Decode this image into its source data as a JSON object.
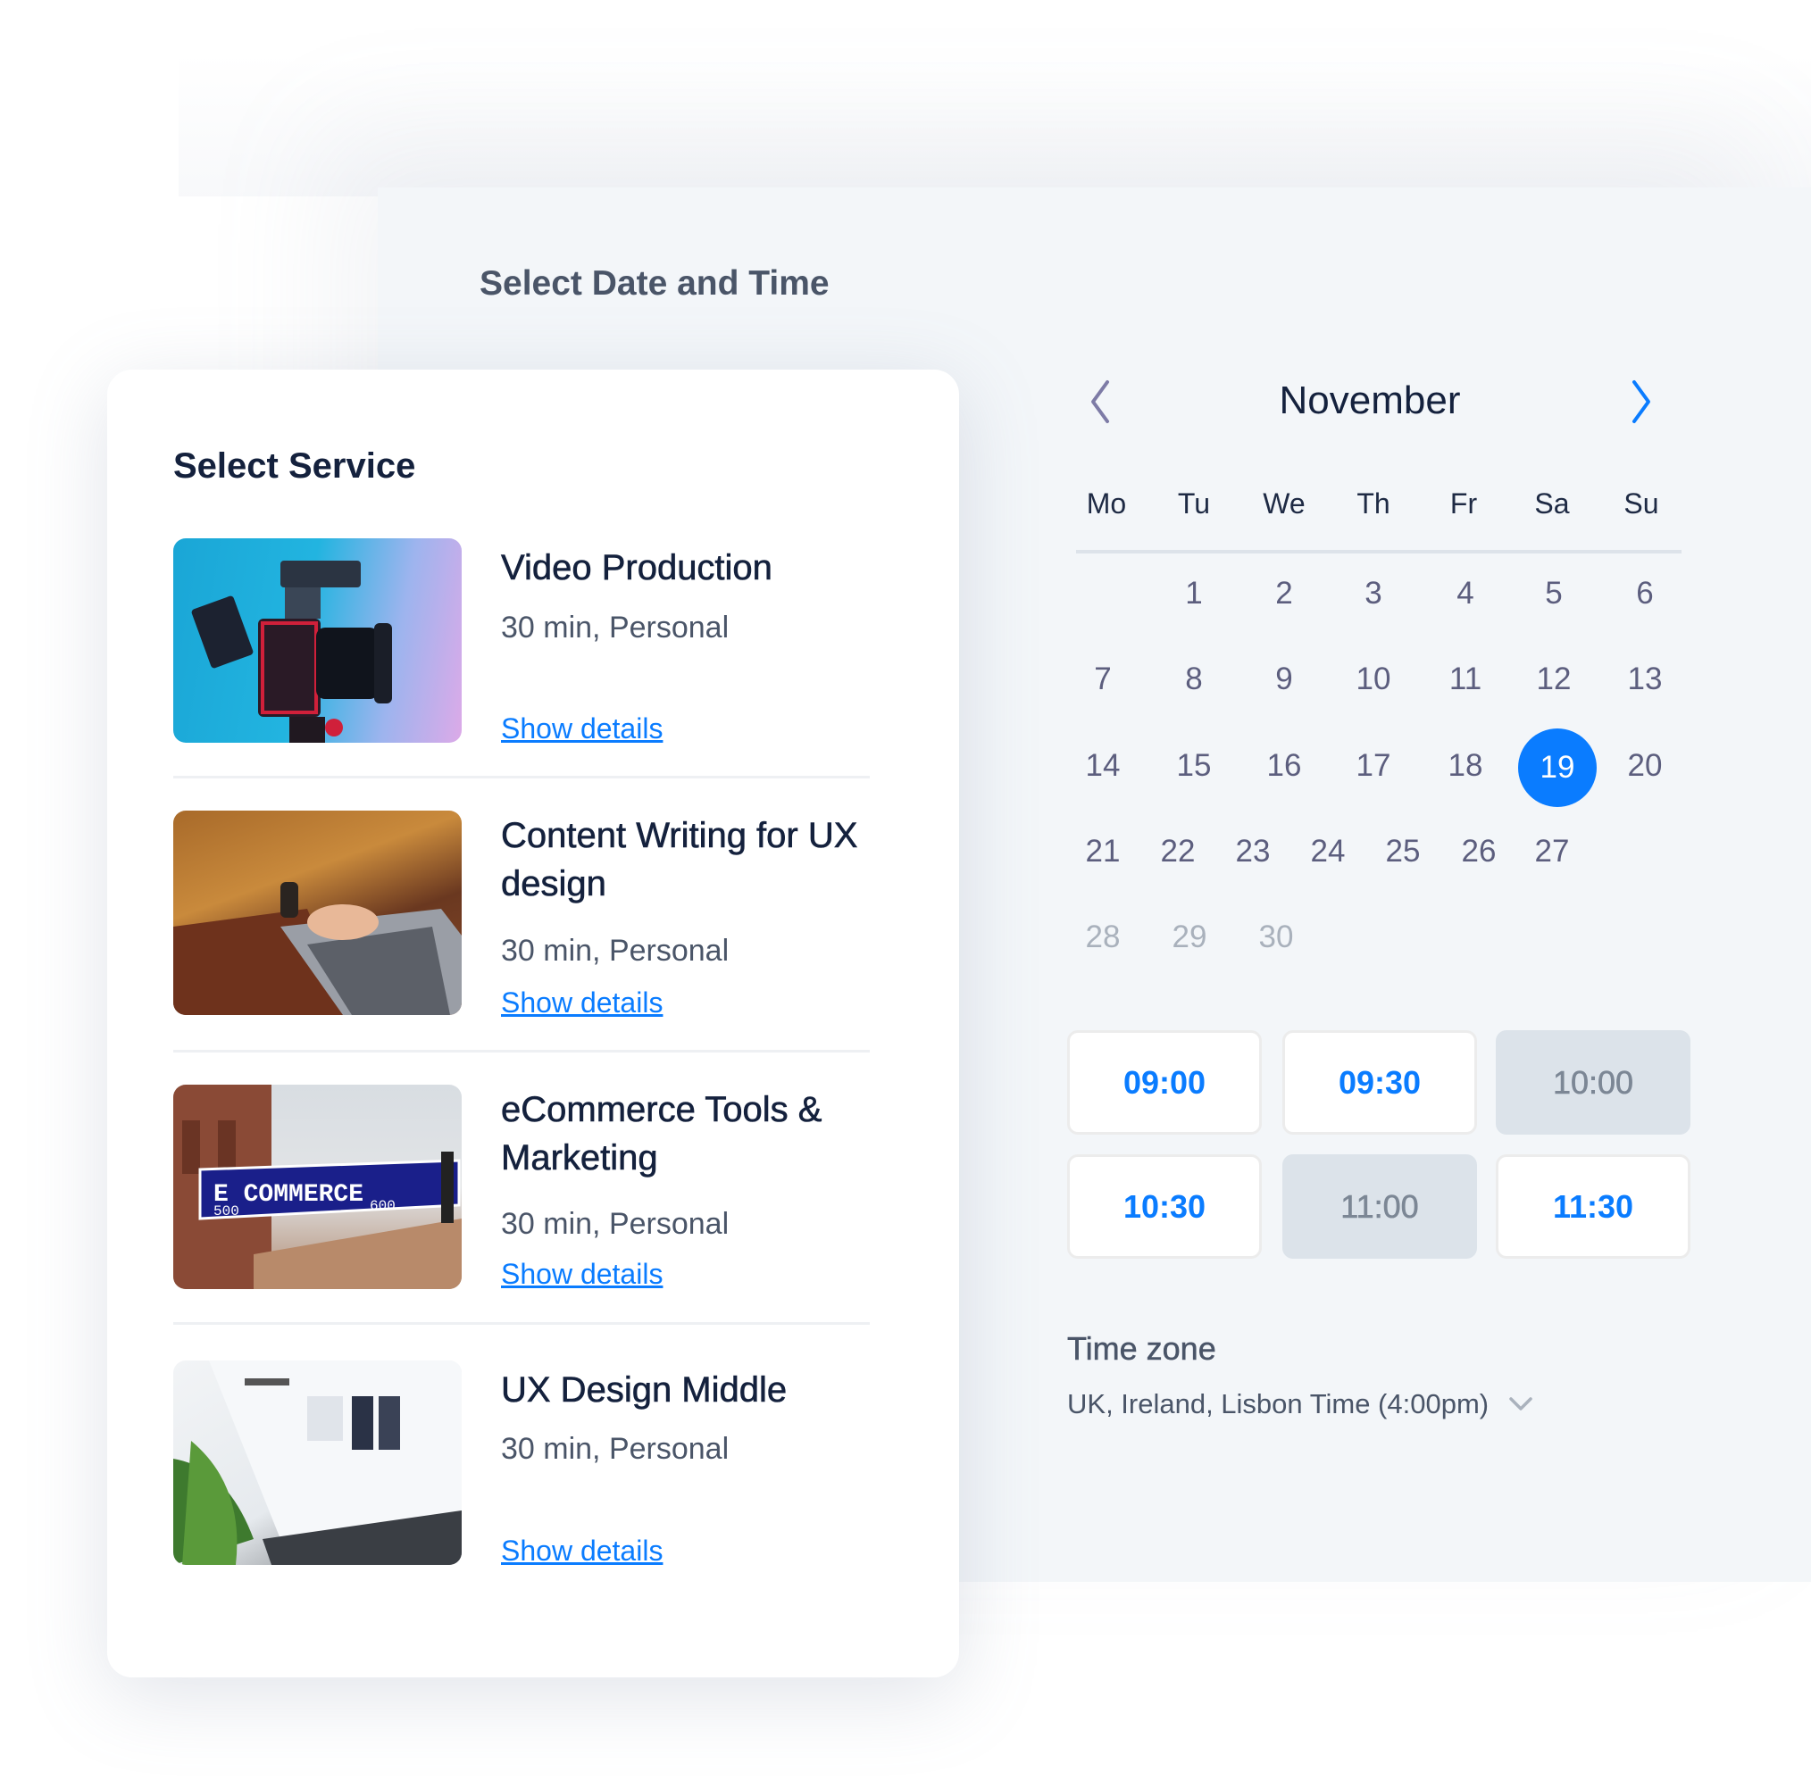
{
  "date_time_panel": {
    "title": "Select Date and Time",
    "calendar": {
      "month": "November",
      "prev_icon": "chevron-left-icon",
      "next_icon": "chevron-right-icon",
      "weekdays": [
        "Mo",
        "Tu",
        "We",
        "Th",
        "Fr",
        "Sa",
        "Su"
      ],
      "weeks": [
        [
          "",
          "1",
          "2",
          "3",
          "4",
          "5",
          "6"
        ],
        [
          "7",
          "8",
          "9",
          "10",
          "11",
          "12",
          "13"
        ],
        [
          "14",
          "15",
          "16",
          "17",
          "18",
          "19",
          "20"
        ],
        [
          "21",
          "22",
          "23",
          "24",
          "25",
          "26",
          "27"
        ],
        [
          "28",
          "29",
          "30"
        ]
      ],
      "selected_day": "19",
      "muted_days": [
        "28",
        "29",
        "30"
      ]
    },
    "time_slots": [
      {
        "time": "09:00",
        "available": true
      },
      {
        "time": "09:30",
        "available": true
      },
      {
        "time": "10:00",
        "available": false
      },
      {
        "time": "10:30",
        "available": true
      },
      {
        "time": "11:00",
        "available": false
      },
      {
        "time": "11:30",
        "available": true
      }
    ],
    "time_zone": {
      "label": "Time zone",
      "value": "UK, Ireland, Lisbon Time (4:00pm)",
      "icon": "chevron-down-icon"
    }
  },
  "service_panel": {
    "title": "Select Service",
    "items": [
      {
        "title": "Video Production",
        "meta": "30 min, Personal",
        "link": "Show details",
        "image": "camera-photo"
      },
      {
        "title": "Content Writing for UX design",
        "meta": "30 min, Personal",
        "link": "Show details",
        "image": "laptop-typing-photo"
      },
      {
        "title": "eCommerce Tools & Marketing",
        "meta": "30 min, Personal",
        "link": "Show details",
        "image": "ecommerce-street-sign-photo"
      },
      {
        "title": "UX Design Middle",
        "meta": "30 min, Personal",
        "link": "Show details",
        "image": "ux-design-monitor-photo"
      }
    ]
  },
  "colors": {
    "accent": "#0a7cff",
    "heading": "#14213d",
    "text": "#4a5568",
    "day": "#5c5e7e",
    "muted": "#a9b1bc",
    "panel_bg": "#f3f6f9",
    "busy_slot": "#dce3ea"
  }
}
